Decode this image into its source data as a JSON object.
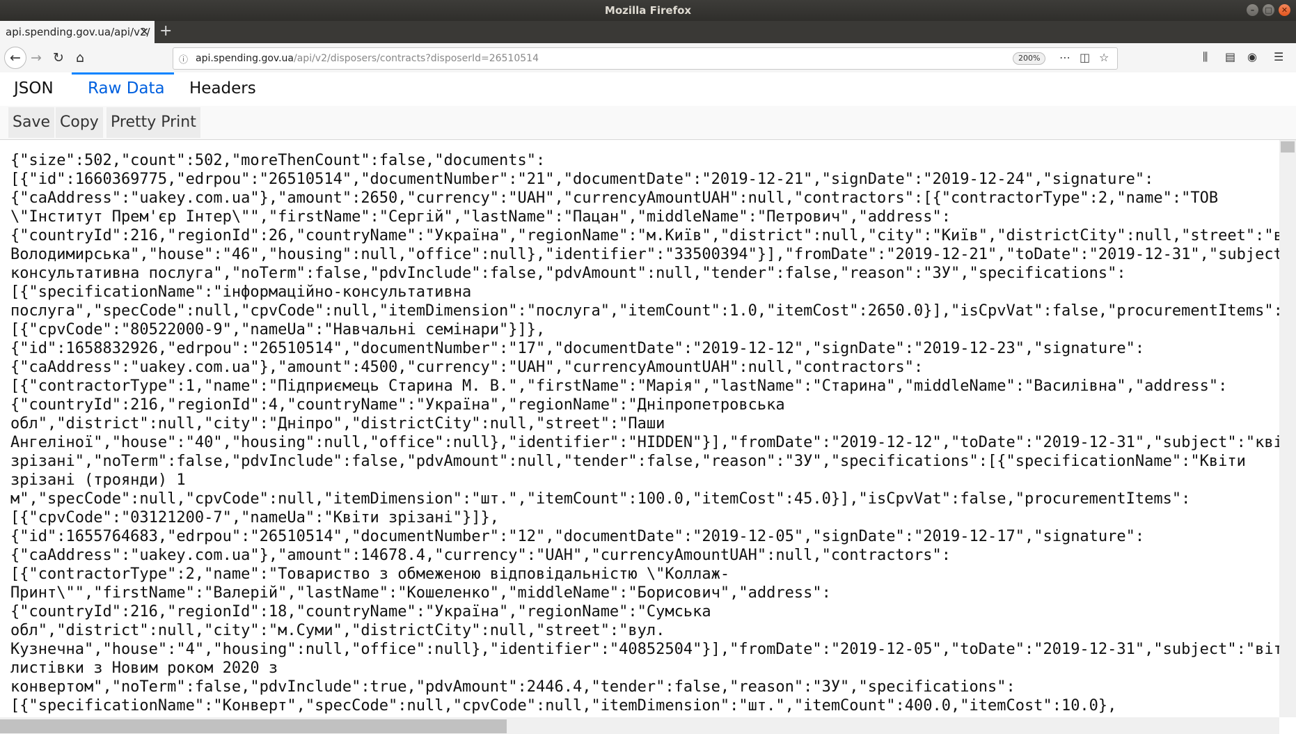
{
  "window": {
    "title": "Mozilla Firefox"
  },
  "tabs": [
    {
      "label": "api.spending.gov.ua/api/v2/"
    }
  ],
  "navigation": {
    "url_host": "api.spending.gov.ua",
    "url_path": "/api/v2/disposers/contracts?disposerId=26510514",
    "zoom": "200%"
  },
  "viewer": {
    "tabs": [
      {
        "label": "JSON",
        "active": false
      },
      {
        "label": "Raw Data",
        "active": true
      },
      {
        "label": "Headers",
        "active": false
      }
    ],
    "actions": [
      {
        "label": "Save"
      },
      {
        "label": "Copy"
      },
      {
        "label": "Pretty Print"
      }
    ]
  },
  "raw_lines": [
    "{\"size\":502,\"count\":502,\"moreThenCount\":false,\"documents\":",
    "[{\"id\":1660369775,\"edrpou\":\"26510514\",\"documentNumber\":\"21\",\"documentDate\":\"2019-12-21\",\"signDate\":\"2019-12-24\",\"signature\":",
    "{\"caAddress\":\"uakey.com.ua\"},\"amount\":2650,\"currency\":\"UAH\",\"currencyAmountUAH\":null,\"contractors\":[{\"contractorType\":2,\"name\":\"ТОВ",
    "\\\"Інститут Прем'єр Інтер\\\"\",\"firstName\":\"Сергій\",\"lastName\":\"Пацан\",\"middleName\":\"Петрович\",\"address\":",
    "{\"countryId\":216,\"regionId\":26,\"countryName\":\"Україна\",\"regionName\":\"м.Київ\",\"district\":null,\"city\":\"Київ\",\"districtCity\":null,\"street\":\"в",
    "Володимирська\",\"house\":\"46\",\"housing\":null,\"office\":null},\"identifier\":\"33500394\"}],\"fromDate\":\"2019-12-21\",\"toDate\":\"2019-12-31\",\"subject",
    "консультативна послуга\",\"noTerm\":false,\"pdvInclude\":false,\"pdvAmount\":null,\"tender\":false,\"reason\":\"ЗУ\",\"specifications\":",
    "[{\"specificationName\":\"інформаційно-консультативна",
    "послуга\",\"specCode\":null,\"cpvCode\":null,\"itemDimension\":\"послуга\",\"itemCount\":1.0,\"itemCost\":2650.0}],\"isCpvVat\":false,\"procurementItems\":",
    "[{\"cpvCode\":\"80522000-9\",\"nameUa\":\"Навчальні семінари\"}]},",
    "{\"id\":1658832926,\"edrpou\":\"26510514\",\"documentNumber\":\"17\",\"documentDate\":\"2019-12-12\",\"signDate\":\"2019-12-23\",\"signature\":",
    "{\"caAddress\":\"uakey.com.ua\"},\"amount\":4500,\"currency\":\"UAH\",\"currencyAmountUAH\":null,\"contractors\":",
    "[{\"contractorType\":1,\"name\":\"Підприємець Старина М. В.\",\"firstName\":\"Марія\",\"lastName\":\"Старина\",\"middleName\":\"Василівна\",\"address\":",
    "{\"countryId\":216,\"regionId\":4,\"countryName\":\"Україна\",\"regionName\":\"Дніпропетровська",
    "обл\",\"district\":null,\"city\":\"Дніпро\",\"districtCity\":null,\"street\":\"Паши",
    "Ангеліної\",\"house\":\"40\",\"housing\":null,\"office\":null},\"identifier\":\"HIDDEN\"}],\"fromDate\":\"2019-12-12\",\"toDate\":\"2019-12-31\",\"subject\":\"кві",
    "зрізані\",\"noTerm\":false,\"pdvInclude\":false,\"pdvAmount\":null,\"tender\":false,\"reason\":\"ЗУ\",\"specifications\":[{\"specificationName\":\"Квіти",
    "зрізані (троянди) 1",
    "м\",\"specCode\":null,\"cpvCode\":null,\"itemDimension\":\"шт.\",\"itemCount\":100.0,\"itemCost\":45.0}],\"isCpvVat\":false,\"procurementItems\":",
    "[{\"cpvCode\":\"03121200-7\",\"nameUa\":\"Квіти зрізані\"}]},",
    "{\"id\":1655764683,\"edrpou\":\"26510514\",\"documentNumber\":\"12\",\"documentDate\":\"2019-12-05\",\"signDate\":\"2019-12-17\",\"signature\":",
    "{\"caAddress\":\"uakey.com.ua\"},\"amount\":14678.4,\"currency\":\"UAH\",\"currencyAmountUAH\":null,\"contractors\":",
    "[{\"contractorType\":2,\"name\":\"Товариство з обмеженою відповідальністю \\\"Коллаж-",
    "Принт\\\"\",\"firstName\":\"Валерій\",\"lastName\":\"Кошеленко\",\"middleName\":\"Борисович\",\"address\":",
    "{\"countryId\":216,\"regionId\":18,\"countryName\":\"Україна\",\"regionName\":\"Сумська",
    "обл\",\"district\":null,\"city\":\"м.Суми\",\"districtCity\":null,\"street\":\"вул.",
    "Кузнечна\",\"house\":\"4\",\"housing\":null,\"office\":null},\"identifier\":\"40852504\"}],\"fromDate\":\"2019-12-05\",\"toDate\":\"2019-12-31\",\"subject\":\"віт",
    "листівки з Новим роком 2020 з",
    "конвертом\",\"noTerm\":false,\"pdvInclude\":true,\"pdvAmount\":2446.4,\"tender\":false,\"reason\":\"ЗУ\",\"specifications\":",
    "[{\"specificationName\":\"Конверт\",\"specCode\":null,\"cpvCode\":null,\"itemDimension\":\"шт.\",\"itemCount\":400.0,\"itemCost\":10.0},"
  ]
}
